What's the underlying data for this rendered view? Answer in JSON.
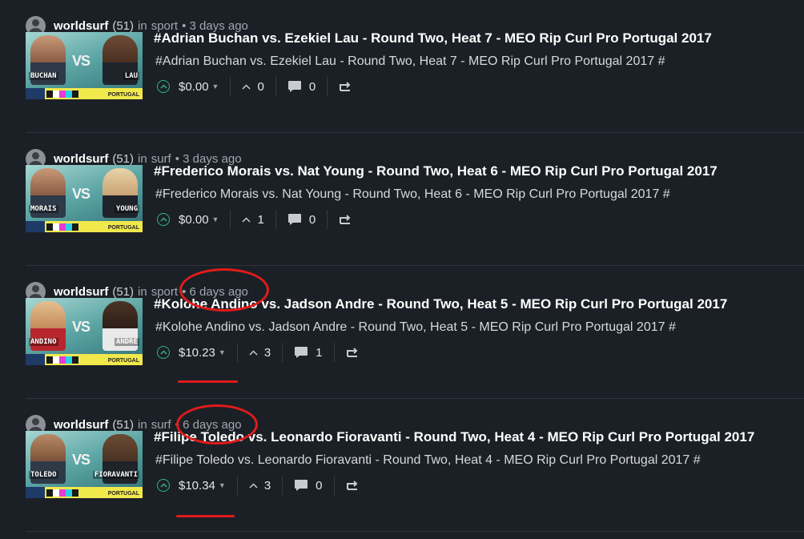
{
  "posts": [
    {
      "author": "worldsurf",
      "reputation": "(51)",
      "in_label": "in",
      "category": "sport",
      "time": "• 3 days ago",
      "title": "#Adrian Buchan vs. Ezekiel Lau - Round Two, Heat 7 - MEO Rip Curl Pro Portugal 2017",
      "description": "#Adrian Buchan vs. Ezekiel Lau - Round Two, Heat 7 - MEO Rip Curl Pro Portugal 2017 #",
      "payout": "$0.00",
      "votes": "0",
      "comments": "0",
      "thumb_left": "BUCHAN",
      "thumb_right": "LAU"
    },
    {
      "author": "worldsurf",
      "reputation": "(51)",
      "in_label": "in",
      "category": "surf",
      "time": "• 3 days ago",
      "title": "#Frederico Morais vs. Nat Young - Round Two, Heat 6 - MEO Rip Curl Pro Portugal 2017",
      "description": "#Frederico Morais vs. Nat Young - Round Two, Heat 6 - MEO Rip Curl Pro Portugal 2017 #",
      "payout": "$0.00",
      "votes": "1",
      "comments": "0",
      "thumb_left": "MORAIS",
      "thumb_right": "YOUNG"
    },
    {
      "author": "worldsurf",
      "reputation": "(51)",
      "in_label": "in",
      "category": "sport",
      "time": "• 6 days ago",
      "title": "#Kolohe Andino vs. Jadson Andre - Round Two, Heat 5 - MEO Rip Curl Pro Portugal 2017",
      "description": "#Kolohe Andino vs. Jadson Andre - Round Two, Heat 5 - MEO Rip Curl Pro Portugal 2017 #",
      "payout": "$10.23",
      "votes": "3",
      "comments": "1",
      "thumb_left": "ANDINO",
      "thumb_right": "ANDRE"
    },
    {
      "author": "worldsurf",
      "reputation": "(51)",
      "in_label": "in",
      "category": "surf",
      "time": "• 6 days ago",
      "title": "#Filipe Toledo vs. Leonardo Fioravanti - Round Two, Heat 4 - MEO Rip Curl Pro Portugal 2017",
      "description": "#Filipe Toledo vs. Leonardo Fioravanti - Round Two, Heat 4 - MEO Rip Curl Pro Portugal 2017 #",
      "payout": "$10.34",
      "votes": "3",
      "comments": "0",
      "thumb_left": "TOLEDO",
      "thumb_right": "FIORAVANTI"
    }
  ],
  "thumb": {
    "vs": "VS",
    "banner_text": "PORTUGAL"
  },
  "icons": {
    "upvote": "upvote-circle-icon",
    "votes": "chevron-up-icon",
    "comments": "speech-bubble-icon",
    "reblog": "reblog-icon"
  },
  "colors": {
    "background": "#1b2026",
    "upvote_green": "#34b38a",
    "annotation_red": "#e01b1b"
  }
}
